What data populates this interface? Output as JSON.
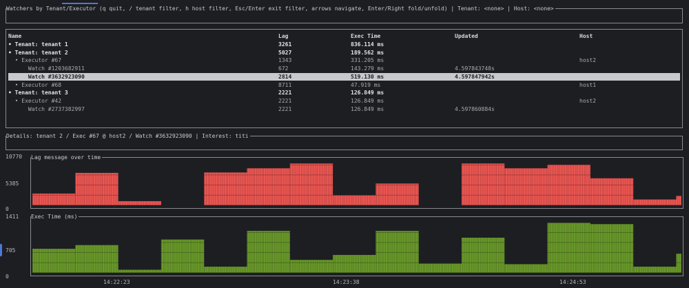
{
  "header": {
    "title": "Watchers by Tenant/Executor (q quit, / tenant filter, h host filter, Esc/Enter exit filter, arrows navigate, Enter/Right fold/unfold) | Tenant: <none> | Host: <none>"
  },
  "table": {
    "columns": [
      "Name",
      "Lag",
      "Exec Time",
      "Updated",
      "Host"
    ],
    "rows": [
      {
        "name": "• Tenant: tenant 1",
        "lag": "3261",
        "exec": "836.114 ms",
        "updated": "",
        "host": "",
        "level": "tenant"
      },
      {
        "name": "• Tenant: tenant 2",
        "lag": "5027",
        "exec": "189.562 ms",
        "updated": "",
        "host": "",
        "level": "tenant"
      },
      {
        "name": "  • Executor #67",
        "lag": "1343",
        "exec": "331.205 ms",
        "updated": "",
        "host": "host2",
        "level": "executor"
      },
      {
        "name": "      Watch #1203682911",
        "lag": "672",
        "exec": "143.279 ms",
        "updated": "4.597843748s",
        "host": "",
        "level": "watch"
      },
      {
        "name": "      Watch #3632923090",
        "lag": "2814",
        "exec": "519.130 ms",
        "updated": "4.597847942s",
        "host": "",
        "level": "watch",
        "selected": true
      },
      {
        "name": "  • Executor #68",
        "lag": "8711",
        "exec": "47.919 ms",
        "updated": "",
        "host": "host1",
        "level": "executor"
      },
      {
        "name": "• Tenant: tenant 3",
        "lag": "2221",
        "exec": "126.849 ms",
        "updated": "",
        "host": "",
        "level": "tenant"
      },
      {
        "name": "  • Executor #42",
        "lag": "2221",
        "exec": "126.849 ms",
        "updated": "",
        "host": "host2",
        "level": "executor"
      },
      {
        "name": "      Watch #2737382997",
        "lag": "2221",
        "exec": "126.849 ms",
        "updated": "4.597860884s",
        "host": "",
        "level": "watch"
      }
    ]
  },
  "details": {
    "title": "Details: tenant 2 / Exec #67 @ host2 / Watch #3632923090 | Interest: titi"
  },
  "chart_data": [
    {
      "type": "bar",
      "title": "Lag message over time",
      "y_ticks": [
        "10770",
        "5385",
        "0"
      ],
      "ylim": [
        0,
        10770
      ],
      "color": "#ee5753",
      "x_ticks": [
        "14:22:23",
        "14:23:38",
        "14:24:53"
      ],
      "values": [
        2830,
        7800,
        1000,
        0,
        7900,
        8900,
        10060,
        2400,
        5240,
        0,
        10060,
        8900,
        9780,
        6500,
        1400,
        2260
      ]
    },
    {
      "type": "bar",
      "title": "Exec Time (ms)",
      "y_ticks": [
        "1411",
        "705",
        "0"
      ],
      "ylim": [
        0,
        1411
      ],
      "color": "#6a9a2a",
      "x_ticks": [
        "14:22:23",
        "14:23:38",
        "14:24:53"
      ],
      "values": [
        640,
        738,
        82,
        886,
        164,
        1116,
        345,
        476,
        1116,
        246,
        935,
        230,
        1329,
        1296,
        164,
        509
      ]
    }
  ]
}
